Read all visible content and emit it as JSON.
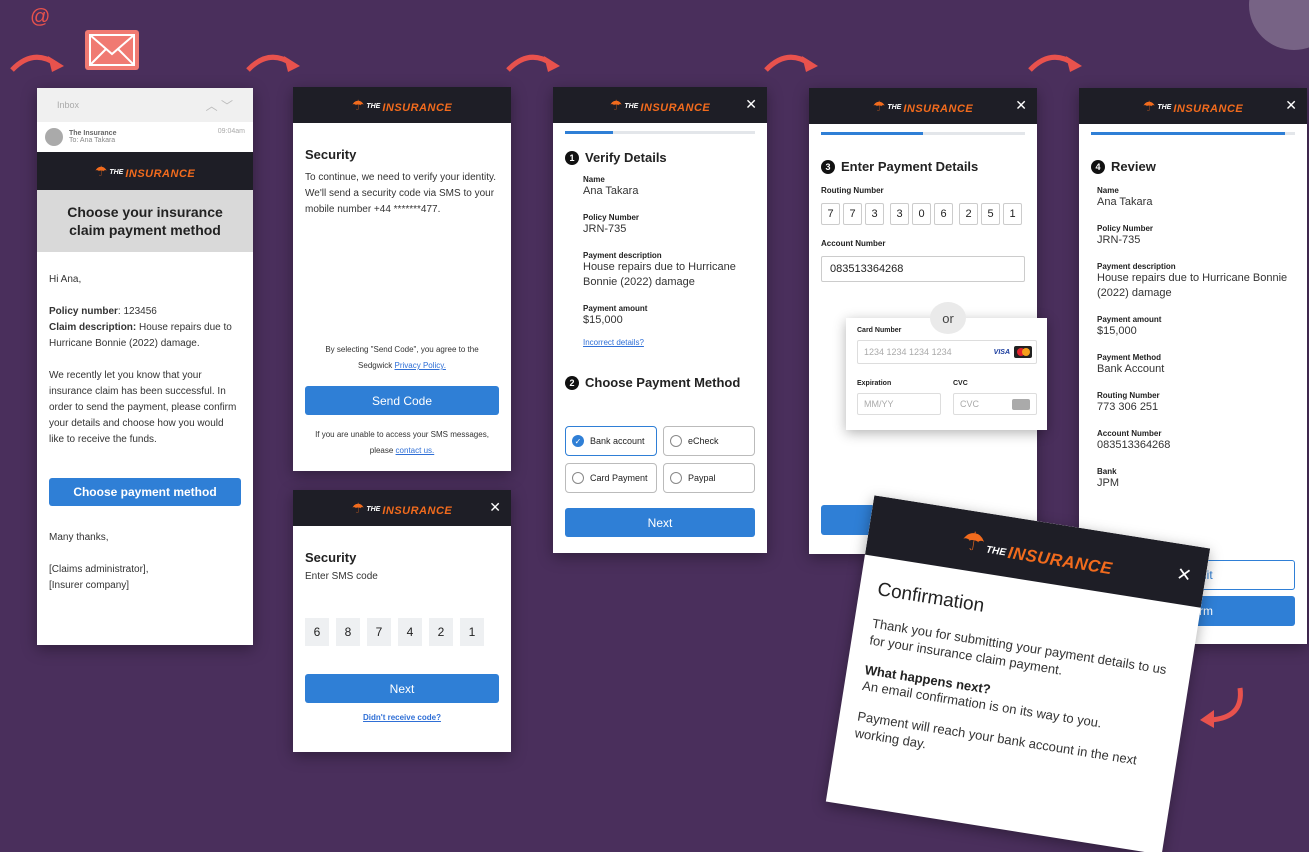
{
  "email": {
    "at_symbol": "@",
    "inbox_label": "Inbox",
    "sender": "The Insurance",
    "to": "To: Ana Takara",
    "time": "09:04am",
    "heading": "Choose your insurance claim payment method",
    "greeting": "Hi Ana,",
    "policy_label": "Policy number",
    "policy_value": ": 123456",
    "claim_label": "Claim description:",
    "claim_value": " House repairs due to Hurricane Bonnie (2022) damage.",
    "body": "We recently let you know that your insurance claim has been successful. In order to send the payment, please confirm your details and choose how you would like to receive the funds.",
    "cta": "Choose payment method",
    "thanks": "Many thanks,",
    "sign1": "[Claims administrator],",
    "sign2": "[Insurer company]"
  },
  "brand": {
    "the": "THE",
    "insurance": "INSURANCE"
  },
  "security": {
    "title": "Security",
    "body": "To continue, we need to verify your identity. We'll send a security code via SMS to your mobile number +44 *******477.",
    "agree_prefix": "By selecting \"Send Code\", you agree to the Sedgwick ",
    "privacy_link": "Privacy Policy.",
    "button": "Send Code",
    "unable_prefix": "If you are unable to access your SMS messages, please ",
    "contact_link": "contact us."
  },
  "sms": {
    "title": "Security",
    "subtitle": "Enter SMS code",
    "digits": [
      "6",
      "8",
      "7",
      "4",
      "2",
      "1"
    ],
    "button": "Next",
    "resend": "Didn't receive code?"
  },
  "verify": {
    "step_num": "1",
    "title": "Verify Details",
    "name_label": "Name",
    "name": "Ana Takara",
    "policy_label": "Policy Number",
    "policy": "JRN-735",
    "desc_label": "Payment description",
    "desc": "House repairs due to Hurricane Bonnie (2022) damage",
    "amount_label": "Payment amount",
    "amount": "$15,000",
    "incorrect": "Incorrect details?",
    "step2_num": "2",
    "step2_title": "Choose Payment Method",
    "options": [
      "Bank account",
      "eCheck",
      "Card Payment",
      "Paypal"
    ],
    "button": "Next",
    "progress": 0.25
  },
  "payment": {
    "step_num": "3",
    "title": "Enter Payment Details",
    "routing_label": "Routing Number",
    "routing_digits": [
      "7",
      "7",
      "3",
      "3",
      "0",
      "6",
      "2",
      "5",
      "1"
    ],
    "account_label": "Account Number",
    "account": "083513364268",
    "or": "or",
    "card_label": "Card Number",
    "card_placeholder": "1234 1234 1234 1234",
    "visa": "VISA",
    "exp_label": "Expiration",
    "exp_placeholder": "MM/YY",
    "cvc_label": "CVC",
    "cvc_placeholder": "CVC",
    "progress": 0.5
  },
  "review": {
    "step_num": "4",
    "title": "Review",
    "name_label": "Name",
    "name": "Ana Takara",
    "policy_label": "Policy Number",
    "policy": "JRN-735",
    "desc_label": "Payment description",
    "desc": "House repairs due to Hurricane Bonnie (2022) damage",
    "amount_label": "Payment amount",
    "amount": "$15,000",
    "method_label": "Payment Method",
    "method": "Bank Account",
    "routing_label": "Routing Number",
    "routing": "773 306 251",
    "account_label": "Account Number",
    "account": "083513364268",
    "bank_label": "Bank",
    "bank": "JPM",
    "edit_partial": "dit",
    "confirm_partial": "rm",
    "progress": 0.95
  },
  "confirmation": {
    "title": "Confirmation",
    "body": "Thank you for submitting your payment details to us for your insurance claim payment.",
    "next_heading": "What happens next?",
    "next_body": "An email confirmation is on its way to you.",
    "reach": "Payment will reach your bank account in the next working day."
  },
  "colors": {
    "background": "#4a2f5c",
    "accent": "#2f7fd6",
    "brand_orange": "#f26b1d",
    "arrow": "#e8524d"
  }
}
